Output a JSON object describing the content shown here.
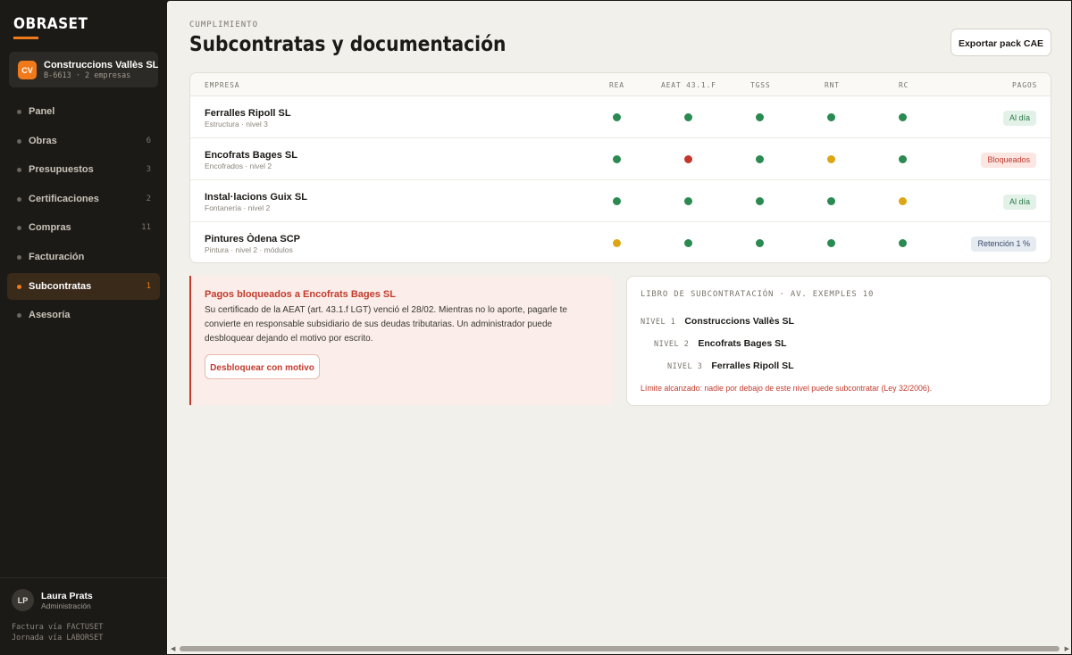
{
  "sidebar": {
    "logo": "OBRASET",
    "company": {
      "initials": "CV",
      "name": "Construccions Vallès SL",
      "sub": "B-6613 · 2 empresas"
    },
    "nav": [
      {
        "label": "Panel",
        "count": ""
      },
      {
        "label": "Obras",
        "count": "6"
      },
      {
        "label": "Presupuestos",
        "count": "3"
      },
      {
        "label": "Certificaciones",
        "count": "2"
      },
      {
        "label": "Compras",
        "count": "11"
      },
      {
        "label": "Facturación",
        "count": ""
      },
      {
        "label": "Subcontratas",
        "count": "1",
        "active": true
      },
      {
        "label": "Asesoría",
        "count": ""
      }
    ],
    "user": {
      "initials": "LP",
      "name": "Laura Prats",
      "role": "Administración"
    },
    "links": [
      "Factura vía FACTUSET",
      "Jornada vía LABORSET"
    ]
  },
  "header": {
    "eyebrow": "CUMPLIMIENTO",
    "title": "Subcontratas y documentación",
    "export_label": "Exportar pack CAE"
  },
  "table": {
    "columns": [
      "EMPRESA",
      "REA",
      "AEAT 43.1.F",
      "TGSS",
      "RNT",
      "RC",
      "PAGOS"
    ],
    "rows": [
      {
        "name": "Ferralles Ripoll SL",
        "sub": "Estructura · nivel 3",
        "status": [
          "ok",
          "ok",
          "ok",
          "ok",
          "ok"
        ],
        "pagos": "Al día",
        "pagos_state": "ok"
      },
      {
        "name": "Encofrats Bages SL",
        "sub": "Encofrados · nivel 2",
        "status": [
          "ok",
          "bad",
          "ok",
          "warn",
          "ok"
        ],
        "pagos": "Bloqueados",
        "pagos_state": "bad"
      },
      {
        "name": "Instal·lacions Guix SL",
        "sub": "Fontanería · nivel 2",
        "status": [
          "ok",
          "ok",
          "ok",
          "ok",
          "warn"
        ],
        "pagos": "Al día",
        "pagos_state": "ok"
      },
      {
        "name": "Pintures Òdena SCP",
        "sub": "Pintura · nivel 2 · módulos",
        "status": [
          "warn",
          "ok",
          "ok",
          "ok",
          "ok"
        ],
        "pagos": "Retención 1 %",
        "pagos_state": "ret"
      }
    ]
  },
  "alert": {
    "title": "Pagos bloqueados a Encofrats Bages SL",
    "body": "Su certificado de la AEAT (art. 43.1.f LGT) venció el 28/02. Mientras no lo aporte, pagarle te convierte en responsable subsidiario de sus deudas tributarias. Un administrador puede desbloquear dejando el motivo por escrito.",
    "button": "Desbloquear con motivo"
  },
  "book": {
    "title": "LIBRO DE SUBCONTRATACIÓN · AV. EXEMPLES 10",
    "levels": [
      {
        "tag": "NIVEL 1",
        "name": "Construccions Vallès SL"
      },
      {
        "tag": "NIVEL 2",
        "name": "Encofrats Bages SL"
      },
      {
        "tag": "NIVEL 3",
        "name": "Ferralles Ripoll SL"
      }
    ],
    "note": "Límite alcanzado: nadie por debajo de este nivel puede subcontratar (Ley 32/2006)."
  },
  "colors": {
    "accent": "#f07a1a",
    "ok": "#2a8a52",
    "warn": "#dca615",
    "bad": "#c3372b"
  }
}
